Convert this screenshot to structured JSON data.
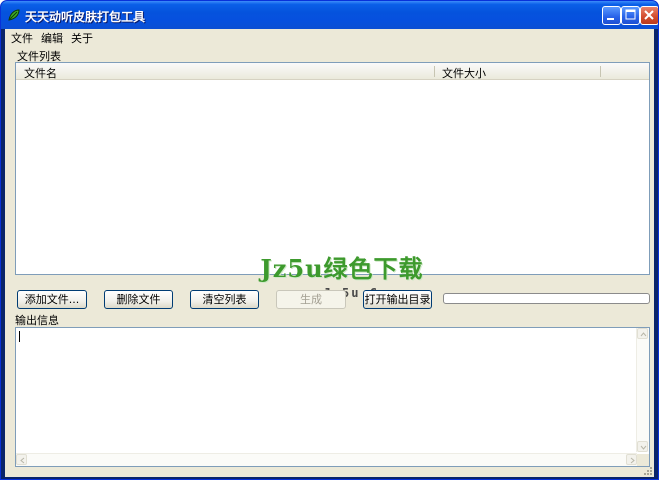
{
  "window": {
    "title": "天天动听皮肤打包工具",
    "icons": {
      "app": "leaf-app-icon",
      "minimize": "minimize-icon",
      "maximize": "maximize-icon",
      "close": "close-icon"
    }
  },
  "menu": {
    "items": [
      "文件",
      "编辑",
      "关于"
    ]
  },
  "file_list": {
    "section_label": "文件列表",
    "columns": [
      "文件名",
      "文件大小"
    ],
    "rows": []
  },
  "watermark": {
    "title": "Jz5u绿色下载",
    "url": "www.Jz5u.Com"
  },
  "buttons": {
    "add_files": "添加文件...",
    "delete_files": "删除文件",
    "clear_list": "清空列表",
    "generate": "生成",
    "open_output_dir": "打开输出目录"
  },
  "progress": {
    "value": 0
  },
  "output": {
    "section_label": "输出信息",
    "text": ""
  },
  "colors": {
    "titlebar": "#0553dd",
    "face": "#ece9d8",
    "field_border": "#7f9db9",
    "button_border": "#003c74",
    "watermark_green": "#3d9a2d"
  }
}
